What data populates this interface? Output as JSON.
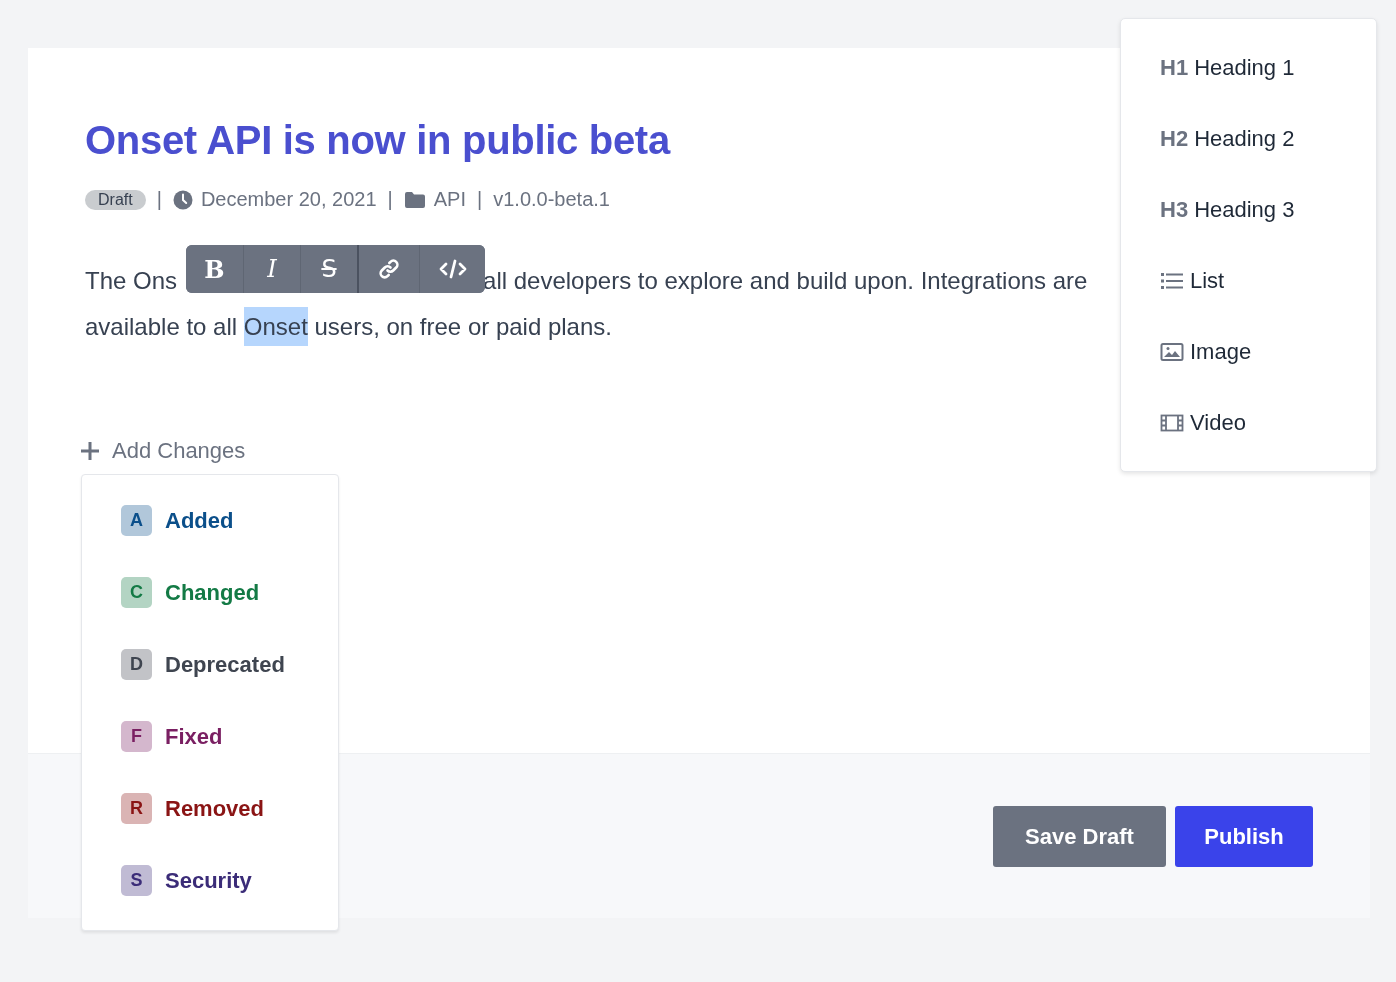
{
  "post": {
    "title": "Onset API is now in public beta",
    "meta": [
      {
        "kind": "status",
        "text": "Draft"
      },
      {
        "kind": "separator",
        "text": "|"
      },
      {
        "kind": "date",
        "text": "December 20, 2021"
      },
      {
        "kind": "separator",
        "text": "|"
      },
      {
        "kind": "category",
        "text": "API"
      },
      {
        "kind": "separator",
        "text": "|"
      },
      {
        "kind": "version",
        "text": "v1.0.0-beta.1"
      }
    ]
  },
  "paragraph": {
    "before_toolbar": "The Ons",
    "after_toolbar": "all developers to explore and build upon. Integrations are available to all ",
    "selected_text": "Onset",
    "end": " users, on free or paid plans."
  },
  "format_toolbar": [
    {
      "kind": "bold",
      "label": "B"
    },
    {
      "kind": "italic",
      "label": "I"
    },
    {
      "kind": "strike",
      "label": "S"
    },
    {
      "kind": "link"
    },
    {
      "kind": "code"
    }
  ],
  "add_changes": {
    "label": "Add Changes"
  },
  "change_types": [
    {
      "letter": "A",
      "label": "Added",
      "color": "#0b4f8a"
    },
    {
      "letter": "C",
      "label": "Changed",
      "color": "#137a45"
    },
    {
      "letter": "D",
      "label": "Deprecated",
      "color": "#3f4550"
    },
    {
      "letter": "F",
      "label": "Fixed",
      "color": "#7a1f62"
    },
    {
      "letter": "R",
      "label": "Removed",
      "color": "#8a1414"
    },
    {
      "letter": "S",
      "label": "Security",
      "color": "#3b2c78"
    }
  ],
  "block_menu": [
    {
      "kind": "heading",
      "prefix": "H1",
      "label": "Heading 1"
    },
    {
      "kind": "heading",
      "prefix": "H2",
      "label": "Heading 2"
    },
    {
      "kind": "heading",
      "prefix": "H3",
      "label": "Heading 3"
    },
    {
      "kind": "list",
      "label": "List"
    },
    {
      "kind": "image",
      "label": "Image"
    },
    {
      "kind": "video",
      "label": "Video"
    }
  ],
  "buttons": [
    {
      "kind": "secondary",
      "label": "Save Draft"
    },
    {
      "kind": "primary",
      "label": "Publish"
    }
  ]
}
